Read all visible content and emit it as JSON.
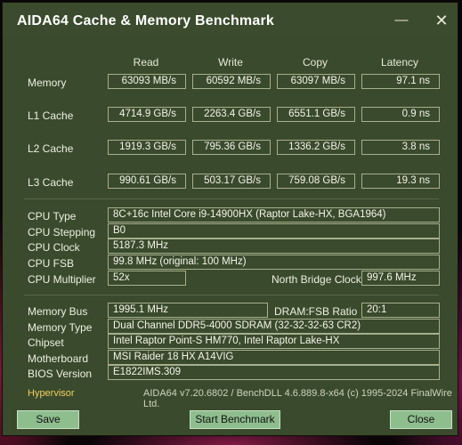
{
  "window": {
    "title": "AIDA64 Cache & Memory Benchmark",
    "minimize_glyph": "—",
    "close_glyph": "✕"
  },
  "columns": [
    "Read",
    "Write",
    "Copy",
    "Latency"
  ],
  "bench_rows": [
    {
      "label": "Memory",
      "read": "63093 MB/s",
      "write": "60592 MB/s",
      "copy": "63097 MB/s",
      "latency": "97.1 ns"
    },
    {
      "label": "L1 Cache",
      "read": "4714.9 GB/s",
      "write": "2263.4 GB/s",
      "copy": "6551.1 GB/s",
      "latency": "0.9 ns"
    },
    {
      "label": "L2 Cache",
      "read": "1919.3 GB/s",
      "write": "795.36 GB/s",
      "copy": "1336.2 GB/s",
      "latency": "3.8 ns"
    },
    {
      "label": "L3 Cache",
      "read": "990.61 GB/s",
      "write": "503.17 GB/s",
      "copy": "759.08 GB/s",
      "latency": "19.3 ns"
    }
  ],
  "cpu": {
    "type_label": "CPU Type",
    "type_value": "8C+16c Intel Core i9-14900HX  (Raptor Lake-HX, BGA1964)",
    "stepping_label": "CPU Stepping",
    "stepping_value": "B0",
    "clock_label": "CPU Clock",
    "clock_value": "5187.3 MHz",
    "fsb_label": "CPU FSB",
    "fsb_value": "99.8 MHz  (original: 100 MHz)",
    "multiplier_label": "CPU Multiplier",
    "multiplier_value": "52x",
    "nb_clock_label": "North Bridge Clock",
    "nb_clock_value": "997.6 MHz"
  },
  "memory": {
    "bus_label": "Memory Bus",
    "bus_value": "1995.1 MHz",
    "ratio_label": "DRAM:FSB Ratio",
    "ratio_value": "20:1",
    "type_label": "Memory Type",
    "type_value": "Dual Channel DDR5-4000 SDRAM  (32-32-32-63 CR2)",
    "chipset_label": "Chipset",
    "chipset_value": "Intel Raptor Point-S HM770, Intel Raptor Lake-HX",
    "motherboard_label": "Motherboard",
    "motherboard_value": "MSI Raider 18 HX A14VIG",
    "bios_label": "BIOS Version",
    "bios_value": "E1822IMS.309"
  },
  "footer": {
    "hypervisor": "Hypervisor",
    "info": "AIDA64 v7.20.6802 / BenchDLL 4.6.889.8-x64  (c) 1995-2024 FinalWire Ltd.",
    "save": "Save",
    "start": "Start Benchmark",
    "close": "Close"
  }
}
